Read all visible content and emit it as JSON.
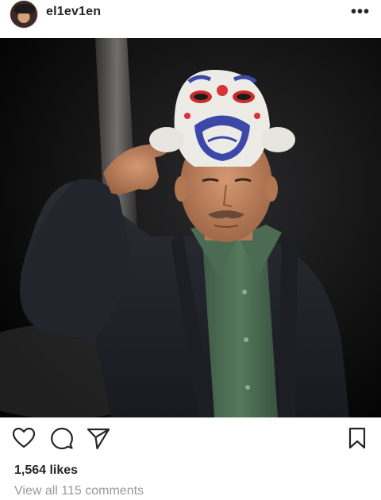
{
  "post": {
    "username": "el1ev1en",
    "more_icon": "more-horizontal-icon",
    "more_label": "•••",
    "likes_text": "1,564 likes",
    "comments_link": "View all 115 comments"
  },
  "actions": {
    "like_icon": "heart-outline-icon",
    "comment_icon": "comment-bubble-icon",
    "share_icon": "paper-plane-icon",
    "save_icon": "bookmark-outline-icon"
  },
  "colors": {
    "text": "#262626",
    "muted": "#999999",
    "photo_bg": "#0c0c0c"
  }
}
